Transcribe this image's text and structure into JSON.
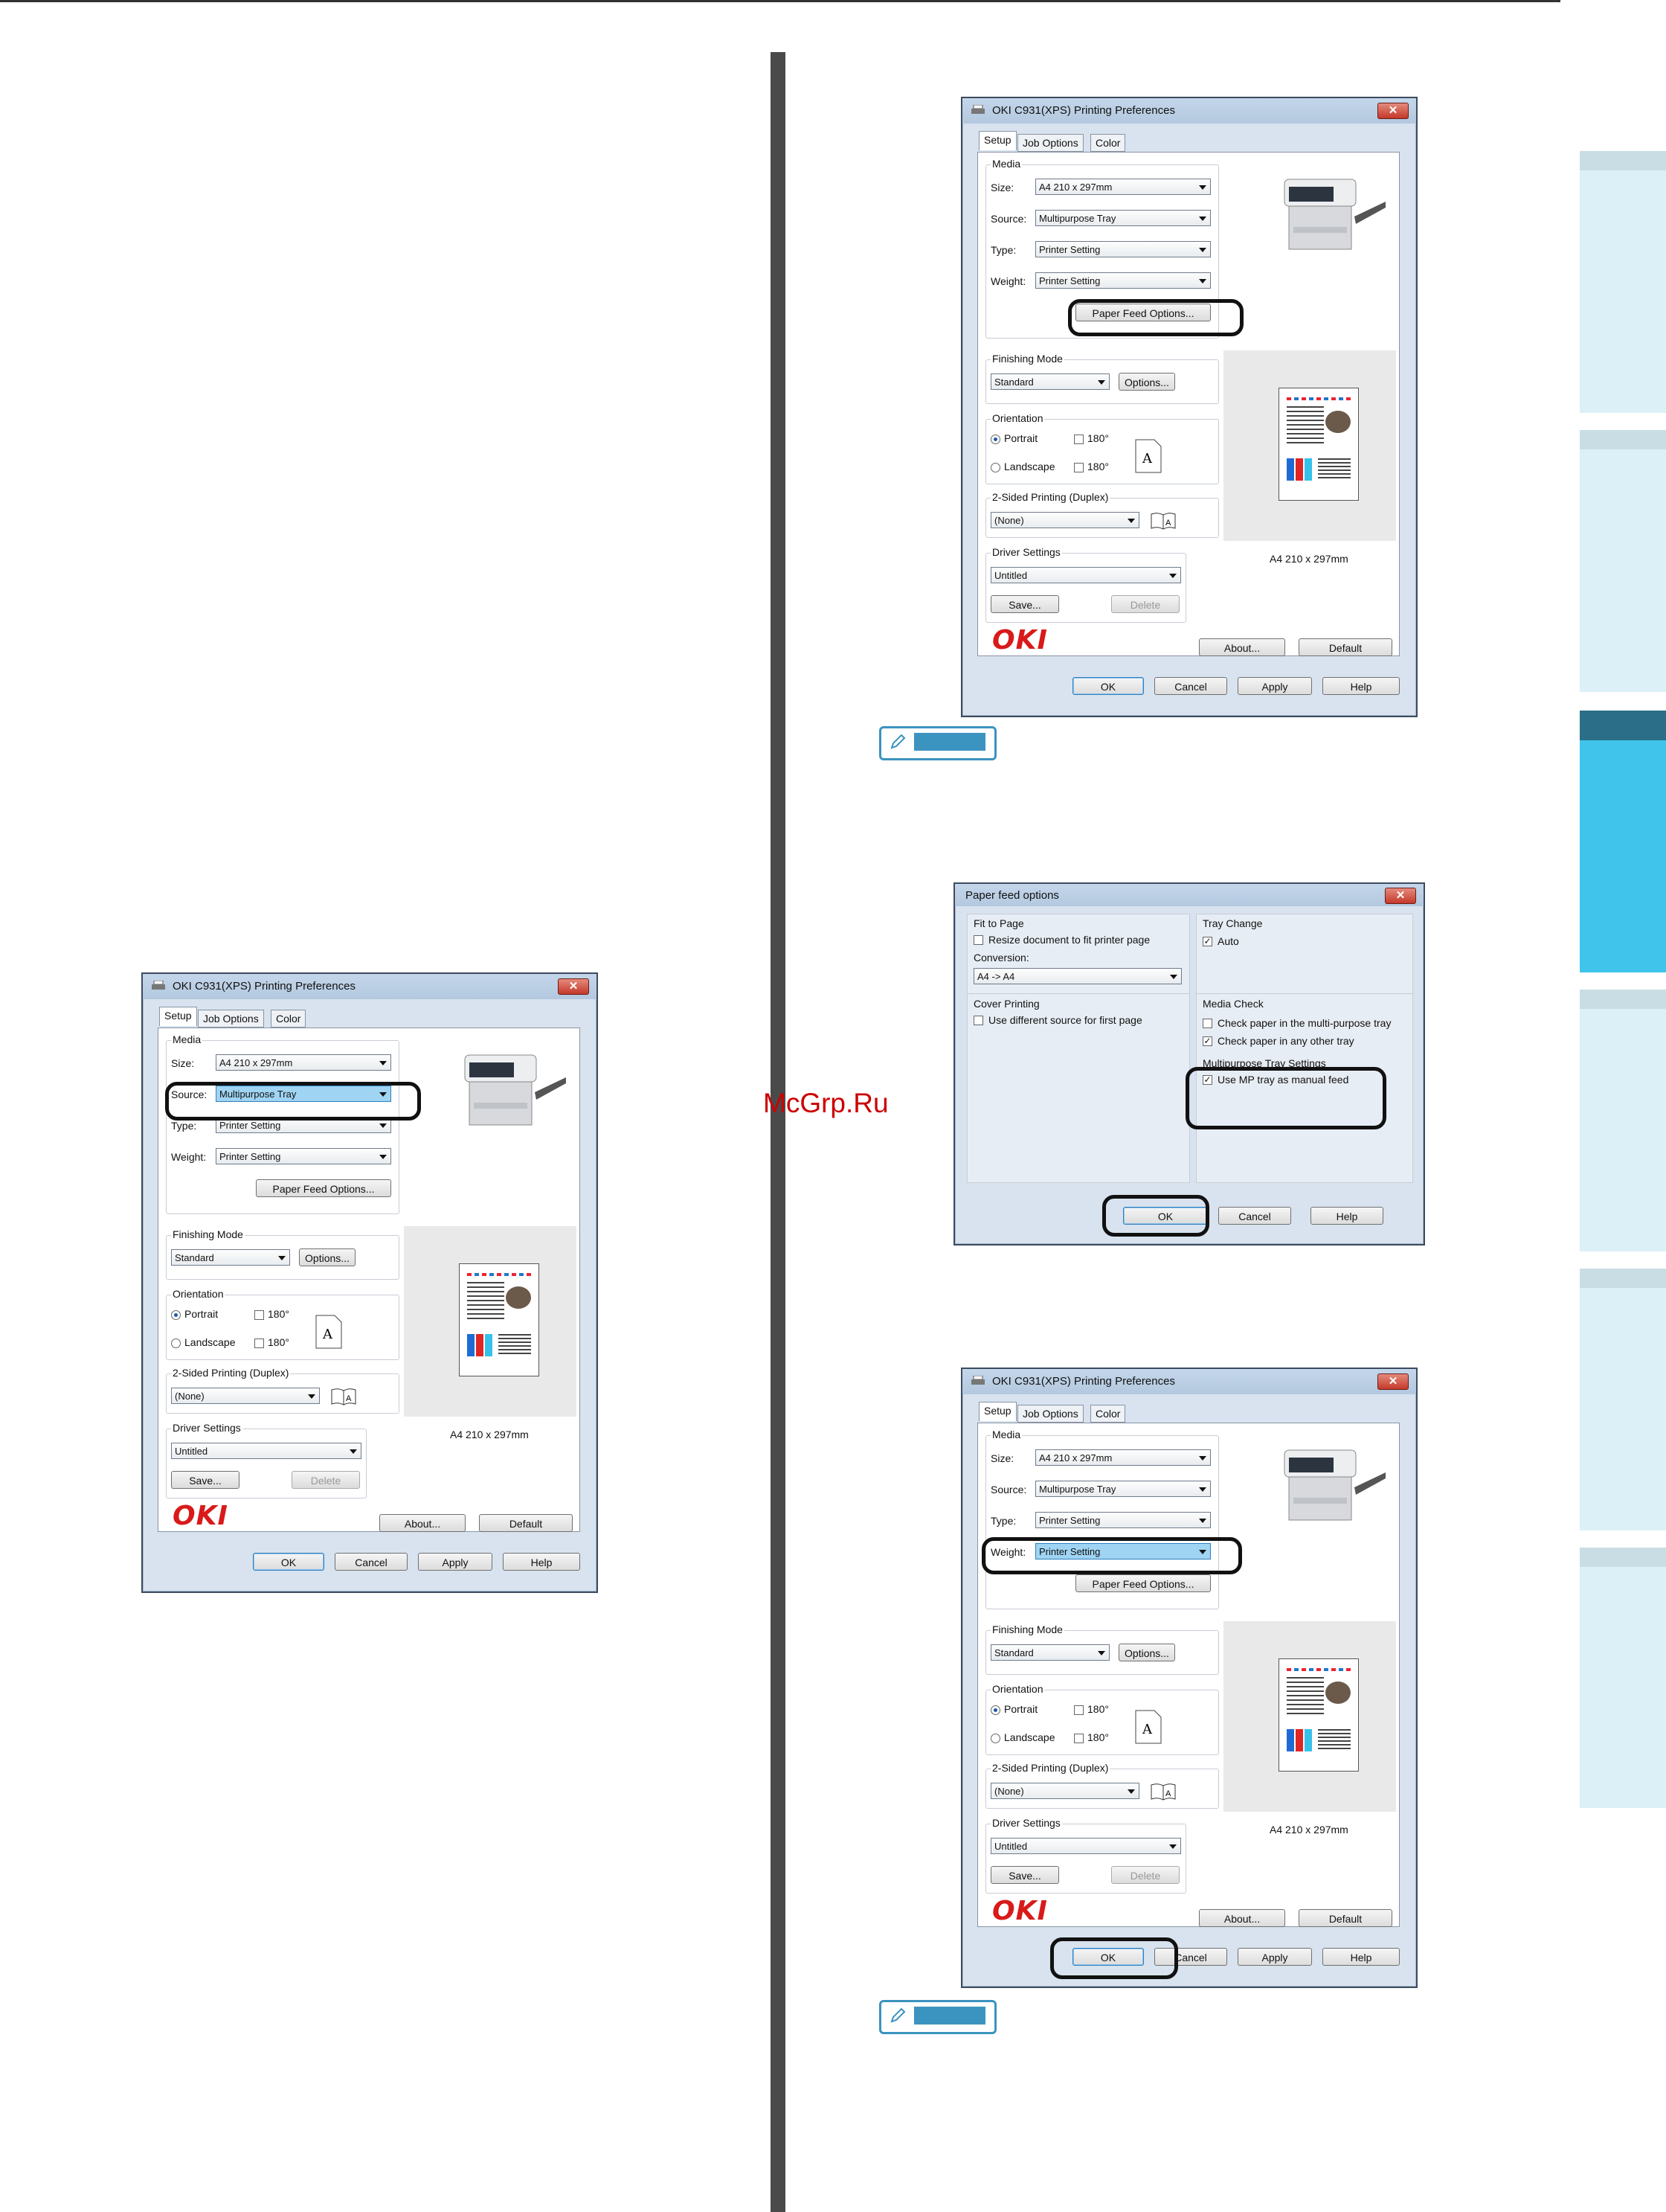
{
  "watermark": "McGrp.Ru",
  "dialog": {
    "title": "OKI C931(XPS) Printing Preferences",
    "tabs": [
      "Setup",
      "Job Options",
      "Color"
    ],
    "media_group": "Media",
    "size_label": "Size:",
    "size_value": "A4 210 x 297mm",
    "source_label": "Source:",
    "source_value": "Multipurpose Tray",
    "type_label": "Type:",
    "type_value": "Printer Setting",
    "weight_label": "Weight:",
    "weight_value": "Printer Setting",
    "paper_feed_btn": "Paper Feed Options...",
    "finishing_group": "Finishing Mode",
    "finishing_value": "Standard",
    "options_btn": "Options...",
    "orientation_group": "Orientation",
    "portrait": "Portrait",
    "landscape": "Landscape",
    "rot180": "180°",
    "duplex_group": "2-Sided Printing (Duplex)",
    "duplex_value": "(None)",
    "driver_group": "Driver Settings",
    "driver_value": "Untitled",
    "save_btn": "Save...",
    "delete_btn": "Delete",
    "preview_caption": "A4 210 x 297mm",
    "logo": "OKI",
    "about_btn": "About...",
    "default_btn": "Default",
    "ok_btn": "OK",
    "cancel_btn": "Cancel",
    "apply_btn": "Apply",
    "help_btn": "Help"
  },
  "feed": {
    "title": "Paper feed options",
    "fit_group": "Fit to Page",
    "resize_label": "Resize document to fit printer page",
    "conversion_label": "Conversion:",
    "conversion_value": "A4 -> A4",
    "cover_group": "Cover Printing",
    "cover_label": "Use different source for first page",
    "tray_change_group": "Tray Change",
    "auto_label": "Auto",
    "media_check_group": "Media Check",
    "check_mp_label": "Check paper in the multi-purpose tray",
    "check_other_label": "Check paper in any other tray",
    "mp_settings_group": "Multipurpose Tray Settings",
    "mp_manual_label": "Use MP tray as manual feed",
    "ok_btn": "OK",
    "cancel_btn": "Cancel",
    "help_btn": "Help"
  }
}
